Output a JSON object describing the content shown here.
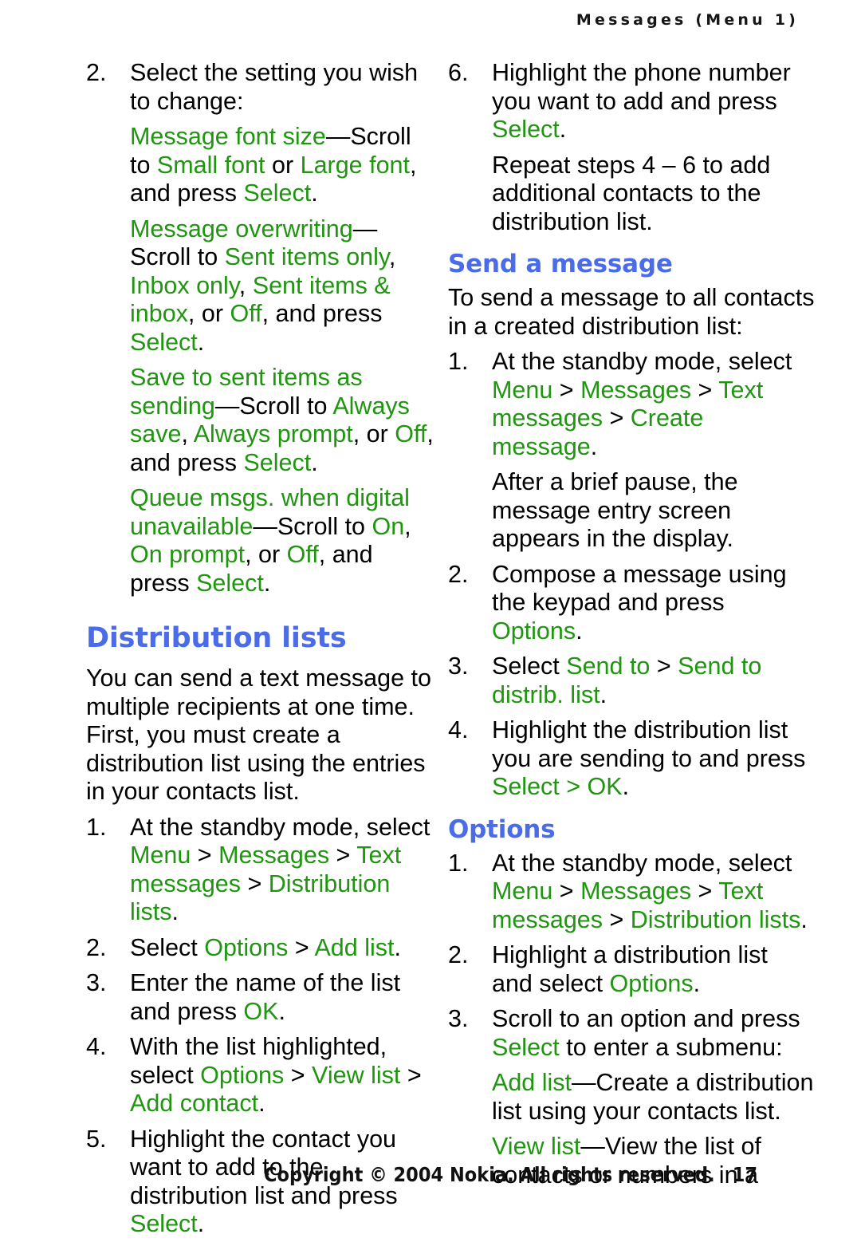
{
  "header": {
    "running_head": "Messages (Menu 1)"
  },
  "colors": {
    "ui_term_green": "#1f9510",
    "heading_blue": "#4a6ce8",
    "body_black": "#000000",
    "page_background": "#ffffff"
  },
  "left_column": {
    "step2": {
      "number": "2.",
      "text": "Select the setting you wish to change:"
    },
    "setting_font_size": {
      "term": "Message font size",
      "mid": "—Scroll to ",
      "opt1": "Small font",
      "or1": " or ",
      "opt2": "Large font",
      "tail": ", and press ",
      "action": "Select",
      "end": "."
    },
    "setting_overwriting": {
      "term": "Message overwriting",
      "mid": "—Scroll to ",
      "opt1": "Sent items only",
      "sep1": ", ",
      "opt2": "Inbox only",
      "sep2": ", ",
      "opt3": "Sent items & inbox",
      "or": ", or ",
      "opt4": "Off",
      "tail": ", and press ",
      "action": "Select",
      "end": "."
    },
    "setting_save_sent": {
      "term": "Save to sent items as sending",
      "mid": "—Scroll to ",
      "opt1": "Always save",
      "sep1": ", ",
      "opt2": "Always prompt",
      "or": ", or ",
      "opt3": "Off",
      "tail": ", and press ",
      "action": "Select",
      "end": "."
    },
    "setting_queue": {
      "term": "Queue msgs. when digital unavailable",
      "mid": "—Scroll to ",
      "opt1": "On",
      "sep1": ", ",
      "opt2": "On prompt",
      "or": ", or ",
      "opt3": "Off",
      "tail": ", and press ",
      "action": "Select",
      "end": "."
    },
    "distribution_heading": "Distribution lists",
    "intro": "You can send a text message to multiple recipients at one time. First, you must create a distribution list using the entries in your contacts list.",
    "step1": {
      "number": "1.",
      "text": "At the standby mode, select ",
      "path1": "Menu",
      "arrow1": " > ",
      "path2": "Messages",
      "arrow2": " > ",
      "path3": "Text messages",
      "arrow3": " > ",
      "path4": "Distribution lists",
      "end": "."
    },
    "step2b": {
      "number": "2.",
      "text": "Select ",
      "path1": "Options",
      "arrow1": " > ",
      "path2": "Add list",
      "end": "."
    },
    "step3": {
      "number": "3.",
      "text": "Enter the name of the list and press ",
      "action": "OK",
      "end": "."
    },
    "step4": {
      "number": "4.",
      "text": "With the list highlighted, select ",
      "path1": "Options",
      "arrow1": " > ",
      "path2": "View list",
      "arrow2": " > ",
      "path3": "Add contact",
      "end": "."
    },
    "step5": {
      "number": "5.",
      "text": "Highlight the contact you want to add to the distribution list and press ",
      "action": "Select",
      "end": "."
    }
  },
  "right_column": {
    "step6": {
      "number": "6.",
      "text": "Highlight the phone number you want to add and press ",
      "action": "Select",
      "end": "."
    },
    "repeat_note": "Repeat steps 4 – 6 to add additional contacts to the distribution list.",
    "send_heading": "Send a message",
    "send_intro": "To send a message to all contacts in a created distribution list:",
    "send_step1": {
      "number": "1.",
      "text": "At the standby mode, select ",
      "path1": "Menu",
      "arrow1": " > ",
      "path2": "Messages",
      "arrow2": " > ",
      "path3": "Text messages",
      "arrow3": " > ",
      "path4": "Create message",
      "end": "."
    },
    "send_note": "After a brief pause, the message entry screen appears in the display.",
    "send_step2": {
      "number": "2.",
      "text": "Compose a message using the keypad and press ",
      "action": "Options",
      "end": "."
    },
    "send_step3": {
      "number": "3.",
      "text": "Select ",
      "path1": "Send to",
      "arrow1": " > ",
      "path2": "Send to distrib. list",
      "end": "."
    },
    "send_step4": {
      "number": "4.",
      "text": "Highlight the distribution list you are sending to and press ",
      "action1": "Select",
      "arrow1": " > ",
      "action2": "OK",
      "end": "."
    },
    "options_heading": "Options",
    "opt_step1": {
      "number": "1.",
      "text": "At the standby mode, select ",
      "path1": "Menu",
      "arrow1": " > ",
      "path2": "Messages",
      "arrow2": " > ",
      "path3": "Text messages",
      "arrow3": " > ",
      "path4": "Distribution lists",
      "end": "."
    },
    "opt_step2": {
      "number": "2.",
      "text": "Highlight a distribution list and select ",
      "action": "Options",
      "end": "."
    },
    "opt_step3": {
      "number": "3.",
      "text": "Scroll to an option and press ",
      "action": "Select",
      "tail": " to enter a submenu:"
    },
    "opt_add_list": {
      "term": "Add list",
      "desc": "—Create a distribution list using your contacts list."
    },
    "opt_view_list": {
      "term": "View list",
      "desc": "—View the list of contacts or numbers in a"
    }
  },
  "footer": {
    "copyright": "Copyright © 2004 Nokia. All rights reserved.",
    "page_number": "17"
  }
}
